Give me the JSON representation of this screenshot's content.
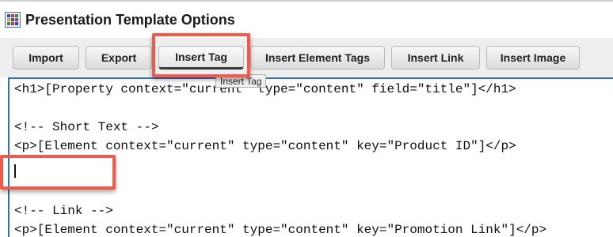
{
  "window": {
    "title": "Presentation Template Options",
    "icon": "template-grid-icon"
  },
  "toolbar": {
    "buttons": [
      {
        "label": "Import"
      },
      {
        "label": "Export"
      },
      {
        "label": "Insert Tag",
        "active": true
      },
      {
        "label": "Insert Element Tags"
      },
      {
        "label": "Insert Link"
      },
      {
        "label": "Insert Image"
      }
    ],
    "tooltip": "Insert Tag"
  },
  "editor": {
    "lines": [
      "<h1>[Property context=\"current\" type=\"content\" field=\"title\"]</h1>",
      "",
      "<!-- Short Text -->",
      "<p>[Element context=\"current\" type=\"content\" key=\"Product ID\"]</p>",
      "",
      "",
      "",
      "<!-- Link -->",
      "<p>[Element context=\"current\" type=\"content\" key=\"Promotion Link\"]</p>"
    ]
  },
  "colors": {
    "highlight": "#ef5a4a",
    "editor_border": "#2d6fc2",
    "toolbar_bg": "#eeeeee"
  }
}
